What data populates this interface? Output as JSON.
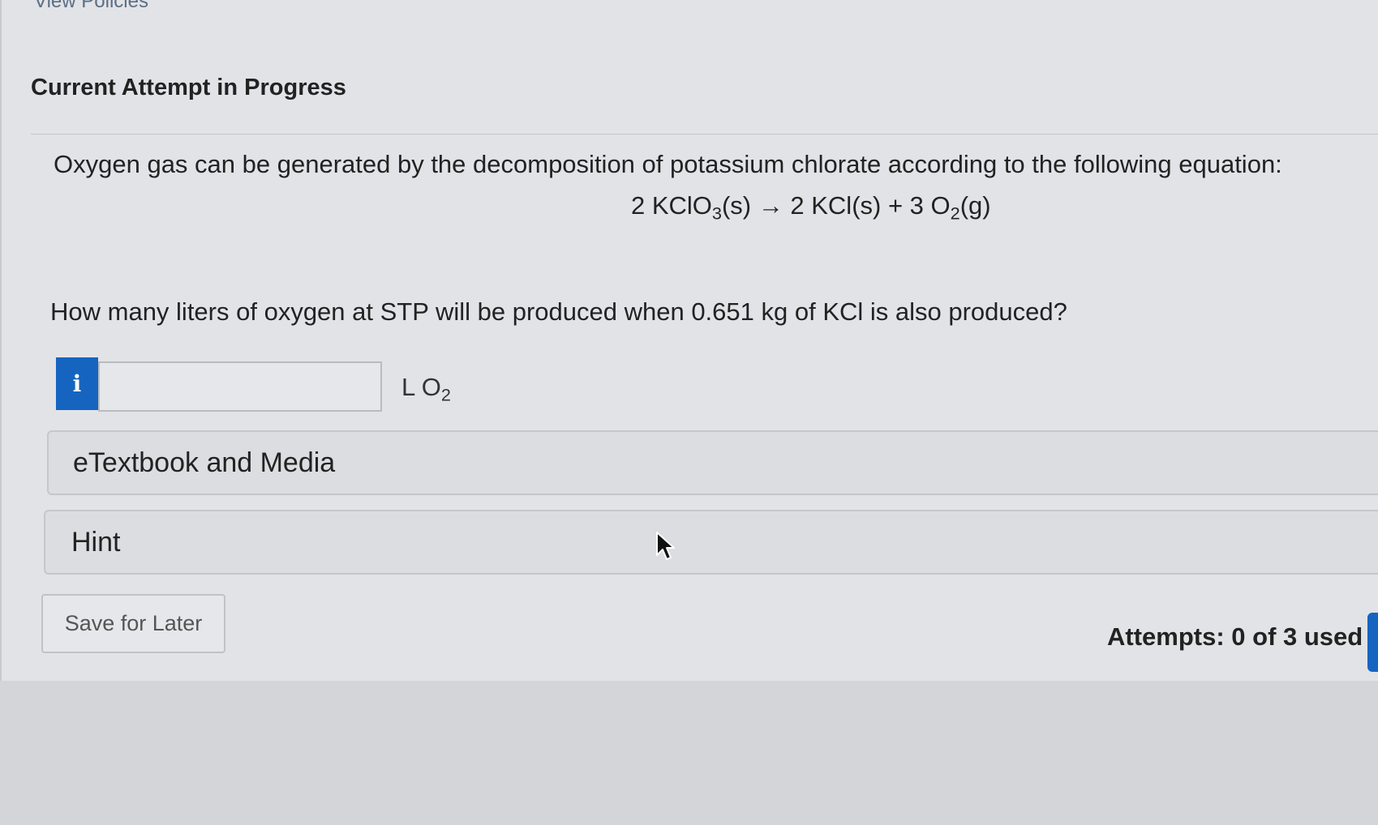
{
  "header": {
    "view_policies": "View Policies",
    "attempt_title": "Current Attempt in Progress"
  },
  "question": {
    "intro": "Oxygen gas can be generated by the decomposition of potassium chlorate according to the following equation:",
    "equation": {
      "reactant_prefix": "2 KClO",
      "reactant_sub": "3",
      "reactant_state": "(s)",
      "arrow": "→",
      "product1": "2 KCl(s) + 3 O",
      "product2_sub": "2",
      "product2_state": "(g)"
    },
    "prompt": "How many liters of oxygen at STP will be produced when 0.651 kg of KCl is also produced?"
  },
  "answer": {
    "info_label": "i",
    "value": "",
    "unit_prefix": "L O",
    "unit_sub": "2"
  },
  "panels": {
    "etextbook": "eTextbook and Media",
    "hint": "Hint"
  },
  "footer": {
    "save_label": "Save for Later",
    "attempts": "Attempts: 0 of 3 used"
  },
  "colors": {
    "accent": "#1565c0",
    "background": "#e2e3e6"
  }
}
